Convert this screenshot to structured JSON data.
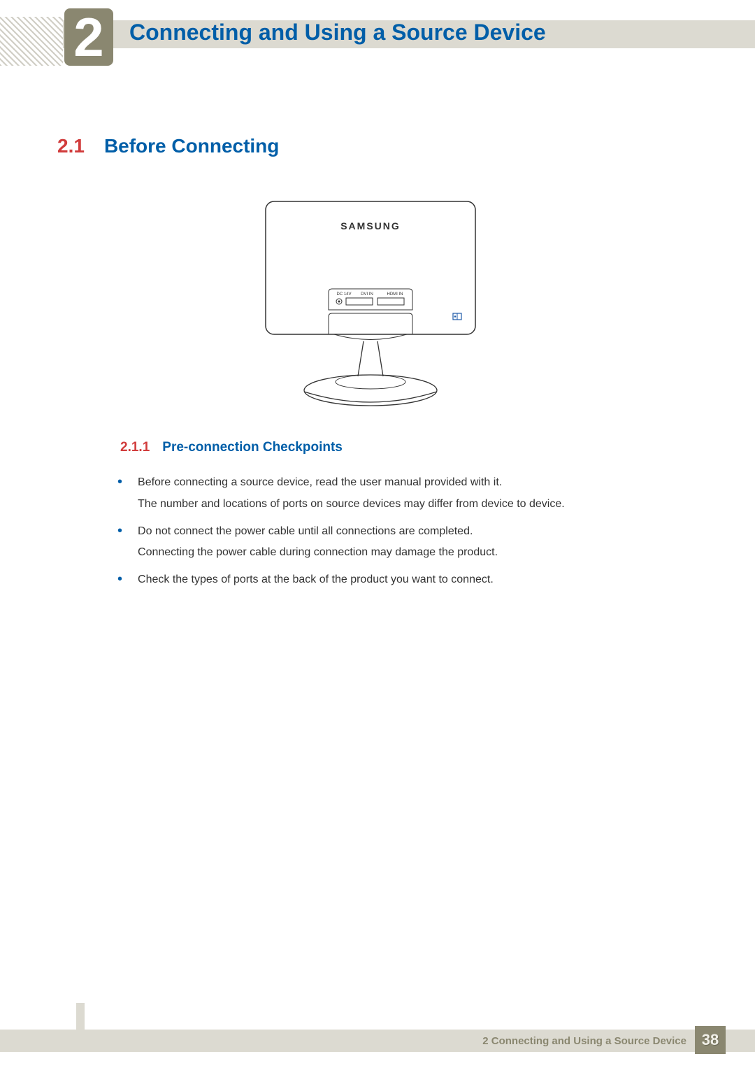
{
  "header": {
    "chapter_number": "2",
    "chapter_title": "Connecting and Using a Source Device"
  },
  "section": {
    "number": "2.1",
    "title": "Before Connecting"
  },
  "illustration": {
    "brand": "SAMSUNG",
    "ports": [
      "DC 14V",
      "DVI IN",
      "HDMI IN"
    ]
  },
  "subsection": {
    "number": "2.1.1",
    "title": "Pre-connection Checkpoints"
  },
  "bullets": [
    {
      "line1": "Before connecting a source device, read the user manual provided with it.",
      "line2": "The number and locations of ports on source devices may differ from device to device."
    },
    {
      "line1": "Do not connect the power cable until all connections are completed.",
      "line2": "Connecting the power cable during connection may damage the product."
    },
    {
      "line1": "Check the types of ports at the back of the product you want to connect.",
      "line2": ""
    }
  ],
  "footer": {
    "text": "2 Connecting and Using a Source Device",
    "page": "38"
  }
}
